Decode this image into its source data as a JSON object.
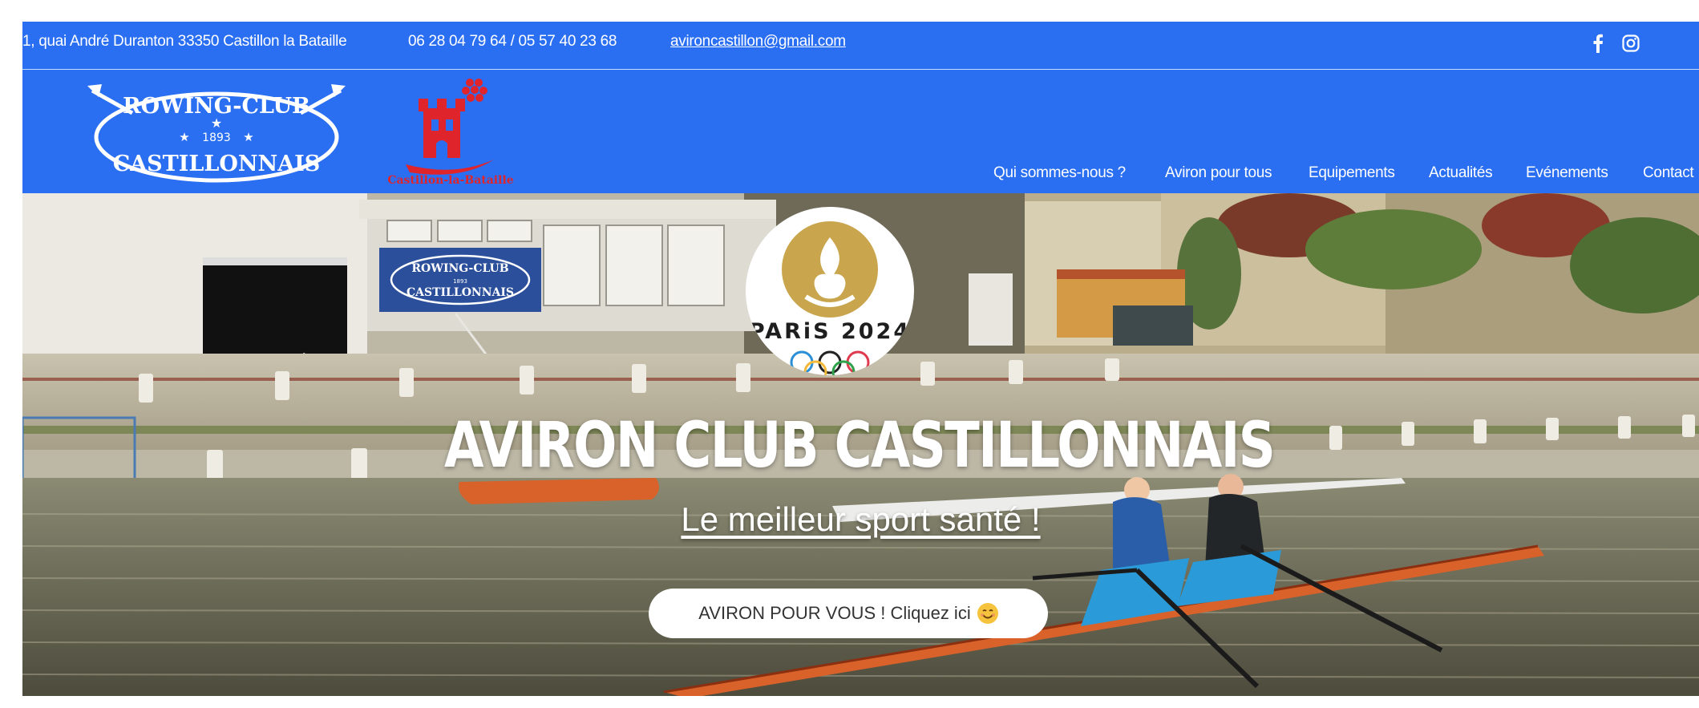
{
  "topbar": {
    "address": "1, quai André Duranton 33350 Castillon la Bataille",
    "phone": "06 28 04 79 64 / 05 57 40 23 68",
    "email": "avironcastillon@gmail.com",
    "social": [
      "facebook-icon",
      "instagram-icon"
    ]
  },
  "logos": {
    "club_line1": "ROWING-CLUB",
    "club_year": "1893",
    "club_line2": "CASTILLONNAIS",
    "city_name": "Castillon-la-Bataille",
    "boathouse_line1": "ROWING-CLUB",
    "boathouse_year": "1893",
    "boathouse_line2": "CASTILLONNAIS"
  },
  "nav": {
    "items": [
      {
        "label": "Qui sommes-nous ?"
      },
      {
        "label": "Aviron pour tous"
      },
      {
        "label": "Equipements"
      },
      {
        "label": "Actualités"
      },
      {
        "label": "Evénements"
      },
      {
        "label": "Contact"
      }
    ]
  },
  "hero": {
    "badge_label": "PARiS 2024",
    "title": "AVIRON CLUB CASTILLONNAIS",
    "subtitle": "Le meilleur sport santé !",
    "cta_label": "AVIRON POUR VOUS ! Cliquez ici"
  },
  "colors": {
    "header_blue": "#2a6ff2",
    "city_red": "#e0242c",
    "gold": "#c9a54d",
    "boat_orange": "#d8622a"
  }
}
